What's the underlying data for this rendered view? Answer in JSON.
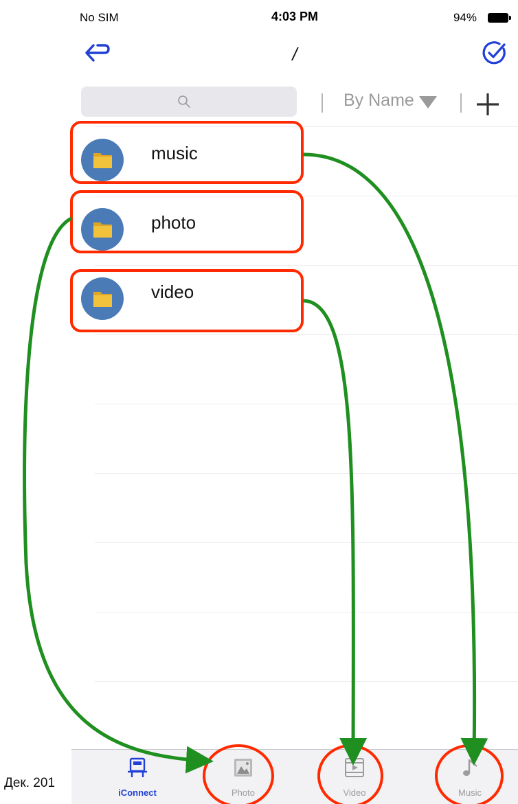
{
  "status_bar": {
    "carrier": "No SIM",
    "time": "4:03 PM",
    "battery": "94%"
  },
  "nav": {
    "title": "/",
    "back_icon": "back-arrow-icon",
    "select_icon": "checkmark-circle-icon"
  },
  "toolbar": {
    "search_placeholder": "",
    "sort_label": "By Name",
    "add_icon": "plus-icon"
  },
  "files": [
    {
      "name": "music",
      "type": "folder"
    },
    {
      "name": "photo",
      "type": "folder"
    },
    {
      "name": "video",
      "type": "folder"
    }
  ],
  "tabs": [
    {
      "label": "iConnect",
      "icon": "device-icon",
      "active": true
    },
    {
      "label": "Photo",
      "icon": "photo-icon",
      "active": false
    },
    {
      "label": "Video",
      "icon": "film-icon",
      "active": false
    },
    {
      "label": "Music",
      "icon": "music-note-icon",
      "active": false
    }
  ],
  "caption": "Дек. 201",
  "colors": {
    "accent": "#1f3fd6",
    "annotation_red": "#ff2a00",
    "annotation_green": "#1f8f1f",
    "folder_circle": "#4a7bb7",
    "folder": "#f2c23c"
  }
}
